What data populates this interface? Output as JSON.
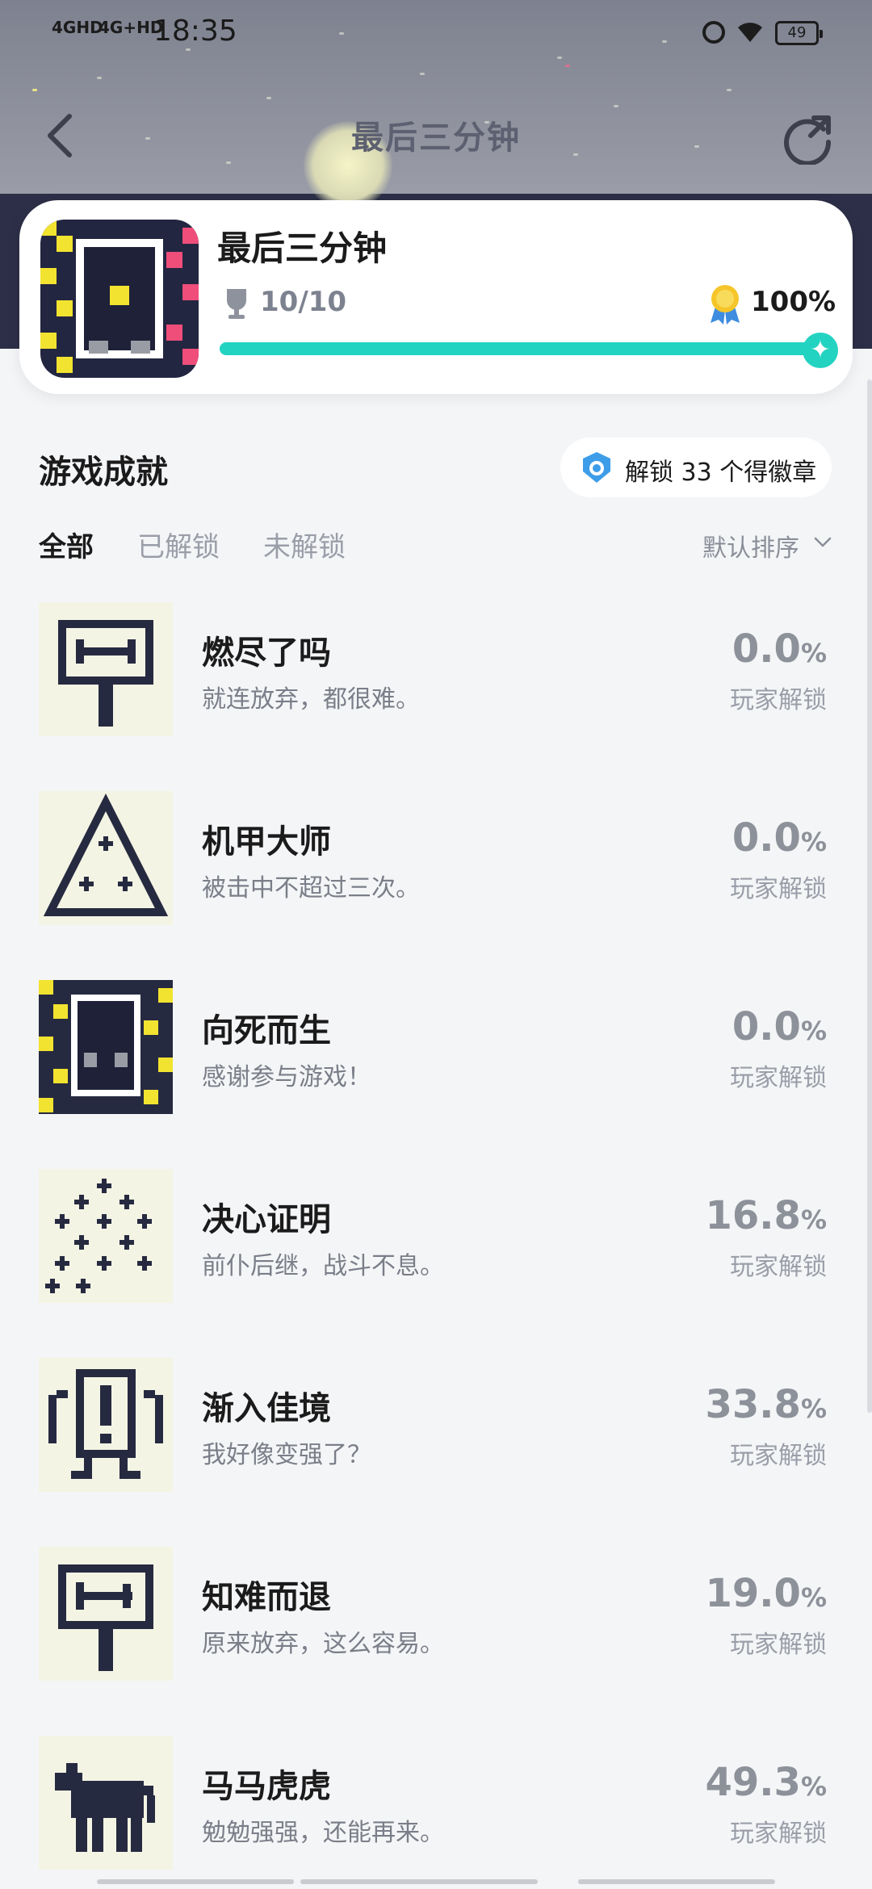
{
  "status": {
    "signal1": "4GHD",
    "signal2": "4G+HD",
    "time": "18:35",
    "battery": "49"
  },
  "nav": {
    "title": "最后三分钟"
  },
  "game": {
    "title": "最后三分钟",
    "progress": "10/10",
    "percent": "100%",
    "progress_fraction": 1.0
  },
  "section": {
    "title": "游戏成就",
    "badge_text": "解锁 33 个得徽章"
  },
  "tabs": [
    {
      "label": "全部"
    },
    {
      "label": "已解锁"
    },
    {
      "label": "未解锁"
    }
  ],
  "sort_label": "默认排序",
  "unlock_label": "玩家解锁",
  "percent_sign": "%",
  "achievements": [
    {
      "name": "燃尽了吗",
      "desc": "就连放弃，都很难。",
      "pct": "0.0"
    },
    {
      "name": "机甲大师",
      "desc": "被击中不超过三次。",
      "pct": "0.0"
    },
    {
      "name": "向死而生",
      "desc": "感谢参与游戏！",
      "pct": "0.0"
    },
    {
      "name": "决心证明",
      "desc": "前仆后继，战斗不息。",
      "pct": "16.8"
    },
    {
      "name": "渐入佳境",
      "desc": "我好像变强了？",
      "pct": "33.8"
    },
    {
      "name": "知难而退",
      "desc": "原来放弃，这么容易。",
      "pct": "19.0"
    },
    {
      "name": "马马虎虎",
      "desc": "勉勉强强，还能再来。",
      "pct": "49.3"
    }
  ],
  "colors": {
    "accent": "#22d3c1",
    "icon_dark": "#262a40",
    "icon_bg": "#f4f4e4"
  }
}
